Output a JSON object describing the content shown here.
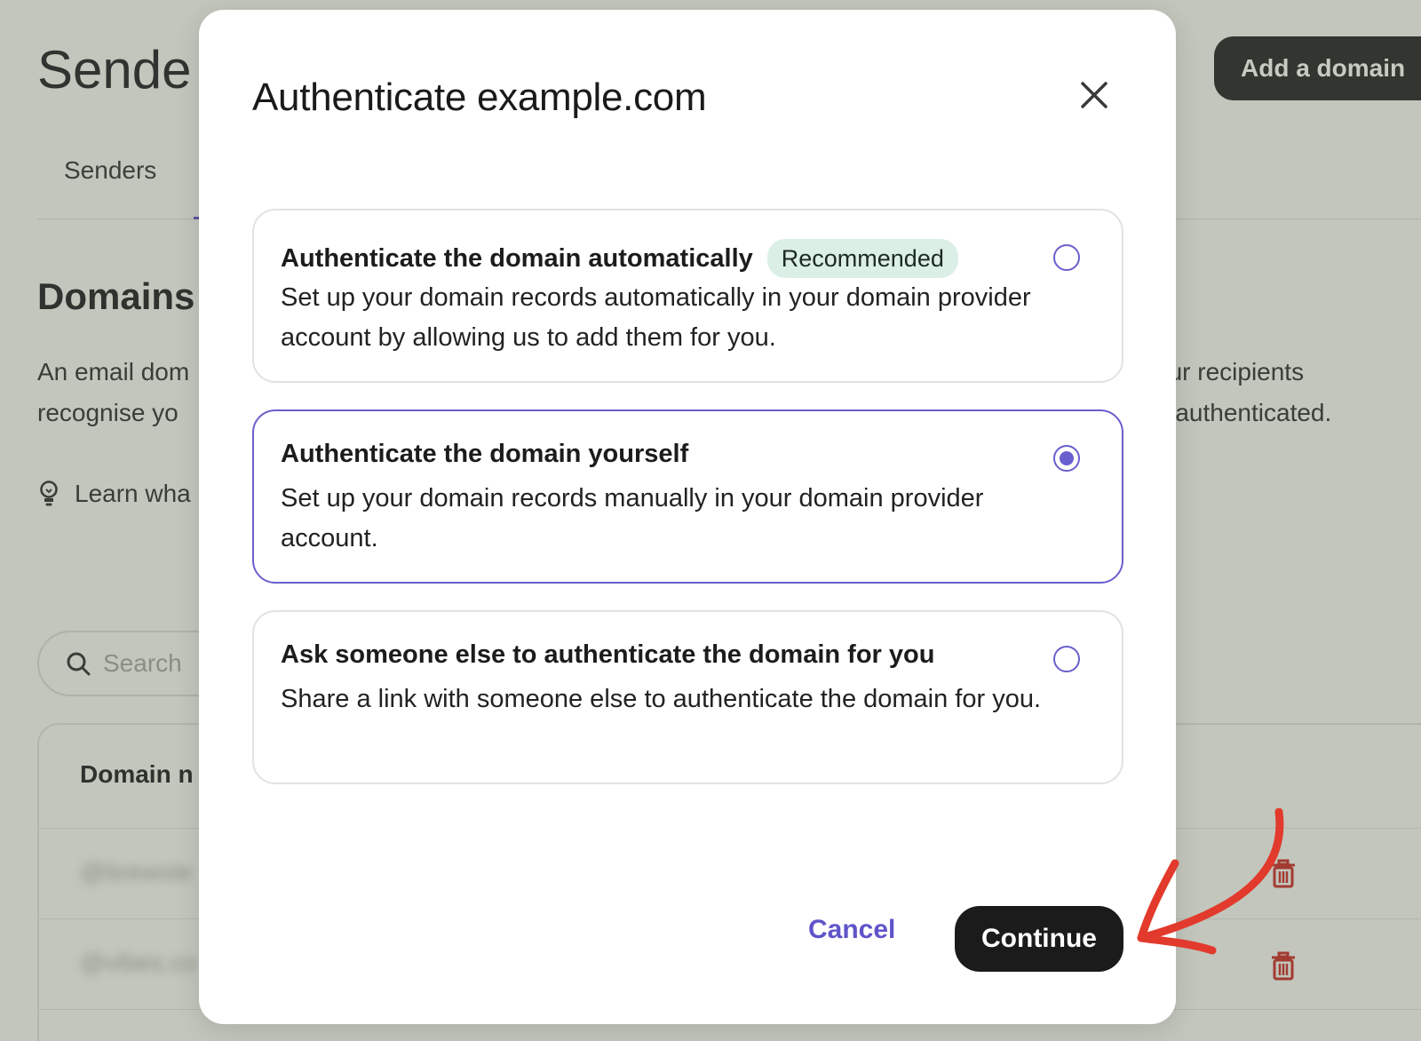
{
  "background": {
    "title": "Sende",
    "add_domain_label": "Add a domain",
    "tab_label": "Senders",
    "section_title": "Domains",
    "description_left_line1": "An email dom",
    "description_left_line2": "recognise yo",
    "description_right_line1": "our recipients",
    "description_right_line2": "e authenticated.",
    "learn_label": "Learn wha",
    "search_placeholder": "Search",
    "table_header": "Domain n",
    "row1": "@brewste",
    "row2": "@vibes.co"
  },
  "modal": {
    "title": "Authenticate example.com",
    "options": [
      {
        "title": "Authenticate the domain automatically",
        "badge": "Recommended",
        "description": "Set up your domain records automatically in your domain provider account by allowing us to add them for you.",
        "selected": false
      },
      {
        "title": "Authenticate the domain yourself",
        "description": "Set up your domain records manually in your domain provider account.",
        "selected": true
      },
      {
        "title": "Ask someone else to authenticate the domain for you",
        "description": "Share a link with someone else to authenticate the domain for you.",
        "selected": false
      }
    ],
    "cancel_label": "Cancel",
    "continue_label": "Continue"
  },
  "colors": {
    "accent": "#6a5fce",
    "primary_button": "#1b1b1b",
    "badge_bg": "#dbefe6",
    "annotation_arrow": "#e23a2c",
    "trash_icon": "#a23b32"
  },
  "icons": [
    "close-icon",
    "radio-icon",
    "search-icon",
    "lightbulb-icon",
    "trash-icon",
    "annotation-arrow"
  ]
}
